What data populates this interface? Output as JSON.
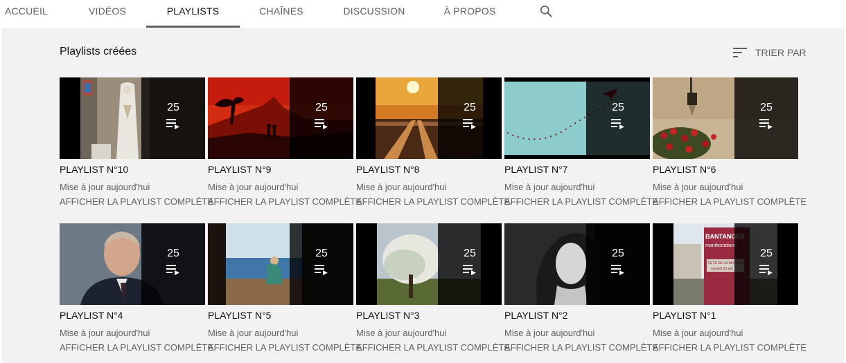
{
  "tabs": [
    {
      "label": "ACCUEIL",
      "active": false
    },
    {
      "label": "VIDÉOS",
      "active": false
    },
    {
      "label": "PLAYLISTS",
      "active": true
    },
    {
      "label": "CHAÎNES",
      "active": false
    },
    {
      "label": "DISCUSSION",
      "active": false
    },
    {
      "label": "À PROPOS",
      "active": false
    }
  ],
  "search_icon": "search-icon",
  "section": {
    "title": "Playlists créées",
    "sort_label": "TRIER PAR"
  },
  "colors": {
    "accent_underline": "#606060",
    "background": "#f2f2f2",
    "overlay": "#1b1b1b"
  },
  "playlists": [
    {
      "title": "PLAYLIST N°10",
      "count": "25",
      "updated": "Mise à jour aujourd'hui",
      "link": "AFFICHER LA PLAYLIST COMPLÈTE",
      "thumb": "church-statue"
    },
    {
      "title": "PLAYLIST N°9",
      "count": "25",
      "updated": "Mise à jour aujourd'hui",
      "link": "AFFICHER LA PLAYLIST COMPLÈTE",
      "thumb": "red-sunset-silhouette"
    },
    {
      "title": "PLAYLIST N°8",
      "count": "25",
      "updated": "Mise à jour aujourd'hui",
      "link": "AFFICHER LA PLAYLIST COMPLÈTE",
      "thumb": "railway-sunrise"
    },
    {
      "title": "PLAYLIST N°7",
      "count": "25",
      "updated": "Mise à jour aujourd'hui",
      "link": "AFFICHER LA PLAYLIST COMPLÈTE",
      "thumb": "paper-plane-hearts"
    },
    {
      "title": "PLAYLIST N°6",
      "count": "25",
      "updated": "Mise à jour aujourd'hui",
      "link": "AFFICHER LA PLAYLIST COMPLÈTE",
      "thumb": "lantern-roses"
    },
    {
      "title": "PLAYLIST N°4",
      "count": "25",
      "updated": "Mise à jour aujourd'hui",
      "link": "AFFICHER LA PLAYLIST COMPLÈTE",
      "thumb": "man-portrait"
    },
    {
      "title": "PLAYLIST N°5",
      "count": "25",
      "updated": "Mise à jour aujourd'hui",
      "link": "AFFICHER LA PLAYLIST COMPLÈTE",
      "thumb": "seaside-woman"
    },
    {
      "title": "PLAYLIST N°3",
      "count": "25",
      "updated": "Mise à jour aujourd'hui",
      "link": "AFFICHER LA PLAYLIST COMPLÈTE",
      "thumb": "blossom-tree"
    },
    {
      "title": "PLAYLIST N°2",
      "count": "25",
      "updated": "Mise à jour aujourd'hui",
      "link": "AFFICHER LA PLAYLIST COMPLÈTE",
      "thumb": "bw-actress"
    },
    {
      "title": "PLAYLIST N°1",
      "count": "25",
      "updated": "Mise à jour aujourd'hui",
      "link": "AFFICHER LA PLAYLIST COMPLÈTE",
      "thumb": "town-sign",
      "sign_text": [
        "BANTANGES",
        "manifestations",
        "FETE DE LA MUSIQUE",
        "samedi 23 juin"
      ]
    }
  ]
}
